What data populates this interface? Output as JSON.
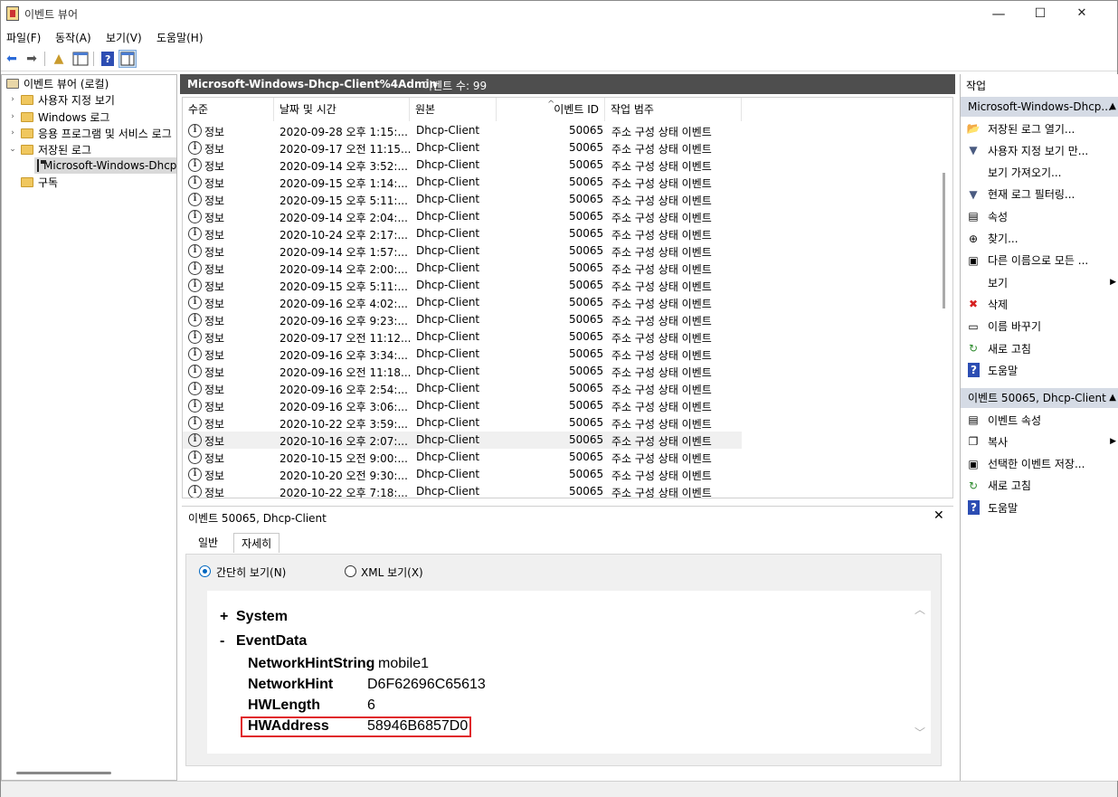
{
  "window": {
    "title": "이벤트 뷰어",
    "controls": [
      "—",
      "☐",
      "✕"
    ]
  },
  "menu": [
    "파일(F)",
    "동작(A)",
    "보기(V)",
    "도움말(H)"
  ],
  "tree": [
    {
      "label": "이벤트 뷰어 (로컬)",
      "indent": 0,
      "twisty": "",
      "icon": "viewer"
    },
    {
      "label": "사용자 지정 보기",
      "indent": 1,
      "twisty": "›",
      "icon": "folder"
    },
    {
      "label": "Windows 로그",
      "indent": 1,
      "twisty": "›",
      "icon": "folder"
    },
    {
      "label": "응용 프로그램 및 서비스 로그",
      "indent": 1,
      "twisty": "›",
      "icon": "folder"
    },
    {
      "label": "저장된 로그",
      "indent": 1,
      "twisty": "⌄",
      "icon": "folder"
    },
    {
      "label": "Microsoft-Windows-Dhcp",
      "indent": 2,
      "twisty": "",
      "icon": "disk",
      "selected": true
    },
    {
      "label": "구독",
      "indent": 1,
      "twisty": "",
      "icon": "folder"
    }
  ],
  "center": {
    "log_name": "Microsoft-Windows-Dhcp-Client%4Admin",
    "event_count": "이벤트 수: 99",
    "columns": [
      "수준",
      "날짜 및 시간",
      "원본",
      "이벤트 ID",
      "작업 범주"
    ],
    "rows": [
      [
        "정보",
        "2020-09-28 오후 1:15:...",
        "Dhcp-Client",
        "50065",
        "주소 구성 상태 이벤트"
      ],
      [
        "정보",
        "2020-09-17 오전 11:15...",
        "Dhcp-Client",
        "50065",
        "주소 구성 상태 이벤트"
      ],
      [
        "정보",
        "2020-09-14 오후 3:52:...",
        "Dhcp-Client",
        "50065",
        "주소 구성 상태 이벤트"
      ],
      [
        "정보",
        "2020-09-15 오후 1:14:...",
        "Dhcp-Client",
        "50065",
        "주소 구성 상태 이벤트"
      ],
      [
        "정보",
        "2020-09-15 오후 5:11:...",
        "Dhcp-Client",
        "50065",
        "주소 구성 상태 이벤트"
      ],
      [
        "정보",
        "2020-09-14 오후 2:04:...",
        "Dhcp-Client",
        "50065",
        "주소 구성 상태 이벤트"
      ],
      [
        "정보",
        "2020-10-24 오후 2:17:...",
        "Dhcp-Client",
        "50065",
        "주소 구성 상태 이벤트"
      ],
      [
        "정보",
        "2020-09-14 오후 1:57:...",
        "Dhcp-Client",
        "50065",
        "주소 구성 상태 이벤트"
      ],
      [
        "정보",
        "2020-09-14 오후 2:00:...",
        "Dhcp-Client",
        "50065",
        "주소 구성 상태 이벤트"
      ],
      [
        "정보",
        "2020-09-15 오후 5:11:...",
        "Dhcp-Client",
        "50065",
        "주소 구성 상태 이벤트"
      ],
      [
        "정보",
        "2020-09-16 오후 4:02:...",
        "Dhcp-Client",
        "50065",
        "주소 구성 상태 이벤트"
      ],
      [
        "정보",
        "2020-09-16 오후 9:23:...",
        "Dhcp-Client",
        "50065",
        "주소 구성 상태 이벤트"
      ],
      [
        "정보",
        "2020-09-17 오전 11:12...",
        "Dhcp-Client",
        "50065",
        "주소 구성 상태 이벤트"
      ],
      [
        "정보",
        "2020-09-16 오후 3:34:...",
        "Dhcp-Client",
        "50065",
        "주소 구성 상태 이벤트"
      ],
      [
        "정보",
        "2020-09-16 오전 11:18...",
        "Dhcp-Client",
        "50065",
        "주소 구성 상태 이벤트"
      ],
      [
        "정보",
        "2020-09-16 오후 2:54:...",
        "Dhcp-Client",
        "50065",
        "주소 구성 상태 이벤트"
      ],
      [
        "정보",
        "2020-09-16 오후 3:06:...",
        "Dhcp-Client",
        "50065",
        "주소 구성 상태 이벤트"
      ],
      [
        "정보",
        "2020-10-22 오후 3:59:...",
        "Dhcp-Client",
        "50065",
        "주소 구성 상태 이벤트"
      ],
      [
        "정보",
        "2020-10-16 오후 2:07:...",
        "Dhcp-Client",
        "50065",
        "주소 구성 상태 이벤트"
      ],
      [
        "정보",
        "2020-10-15 오전 9:00:...",
        "Dhcp-Client",
        "50065",
        "주소 구성 상태 이벤트"
      ],
      [
        "정보",
        "2020-10-20 오전 9:30:...",
        "Dhcp-Client",
        "50065",
        "주소 구성 상태 이벤트"
      ],
      [
        "정보",
        "2020-10-22 오후 7:18:...",
        "Dhcp-Client",
        "50065",
        "주소 구성 상태 이벤트"
      ]
    ],
    "selected_row_index": 18
  },
  "detail": {
    "header": "이벤트 50065, Dhcp-Client",
    "close": "✕",
    "tabs": [
      "일반",
      "자세히"
    ],
    "active_tab": "자세히",
    "radio_friendly": "간단히 보기(N)",
    "radio_xml": "XML 보기(X)",
    "system_toggle": "+",
    "system_label": "System",
    "eventdata_toggle": "-",
    "eventdata_label": "EventData",
    "fields": [
      {
        "name": "NetworkHintString",
        "value": "mobile1"
      },
      {
        "name": "NetworkHint",
        "value": "D6F62696C65613"
      },
      {
        "name": "HWLength",
        "value": "6"
      },
      {
        "name": "HWAddress",
        "value": "58946B6857D0"
      }
    ],
    "highlight_color": "#e0262b"
  },
  "actions": {
    "header": "작업",
    "section1": "Microsoft-Windows-Dhcp...",
    "items1": [
      {
        "label": "저장된 로그 열기...",
        "icon": "open-folder-icon",
        "glyph": "📂"
      },
      {
        "label": "사용자 지정 보기 만...",
        "icon": "filter-icon",
        "glyph": "▼"
      },
      {
        "label": "보기 가져오기...",
        "icon": "",
        "glyph": ""
      },
      {
        "label": "현재 로그 필터링...",
        "icon": "filter-icon",
        "glyph": "▼"
      },
      {
        "label": "속성",
        "icon": "properties-icon",
        "glyph": "▤"
      },
      {
        "label": "찾기...",
        "icon": "binoculars-icon",
        "glyph": "⊕"
      },
      {
        "label": "다른 이름으로 모든 ...",
        "icon": "save-icon",
        "glyph": "▣"
      },
      {
        "label": "보기",
        "icon": "",
        "glyph": "",
        "submenu": true
      },
      {
        "label": "삭제",
        "icon": "delete-icon",
        "glyph": "✖"
      },
      {
        "label": "이름 바꾸기",
        "icon": "rename-icon",
        "glyph": "▭"
      },
      {
        "label": "새로 고침",
        "icon": "refresh-icon",
        "glyph": "↻"
      },
      {
        "label": "도움말",
        "icon": "help-icon",
        "glyph": "?"
      }
    ],
    "section2": "이벤트 50065, Dhcp-Client",
    "items2": [
      {
        "label": "이벤트 속성",
        "icon": "properties-icon",
        "glyph": "▤"
      },
      {
        "label": "복사",
        "icon": "copy-icon",
        "glyph": "❐",
        "submenu": true
      },
      {
        "label": "선택한 이벤트 저장...",
        "icon": "save-icon",
        "glyph": "▣"
      },
      {
        "label": "새로 고침",
        "icon": "refresh-icon",
        "glyph": "↻"
      },
      {
        "label": "도움말",
        "icon": "help-icon",
        "glyph": "?"
      }
    ]
  }
}
